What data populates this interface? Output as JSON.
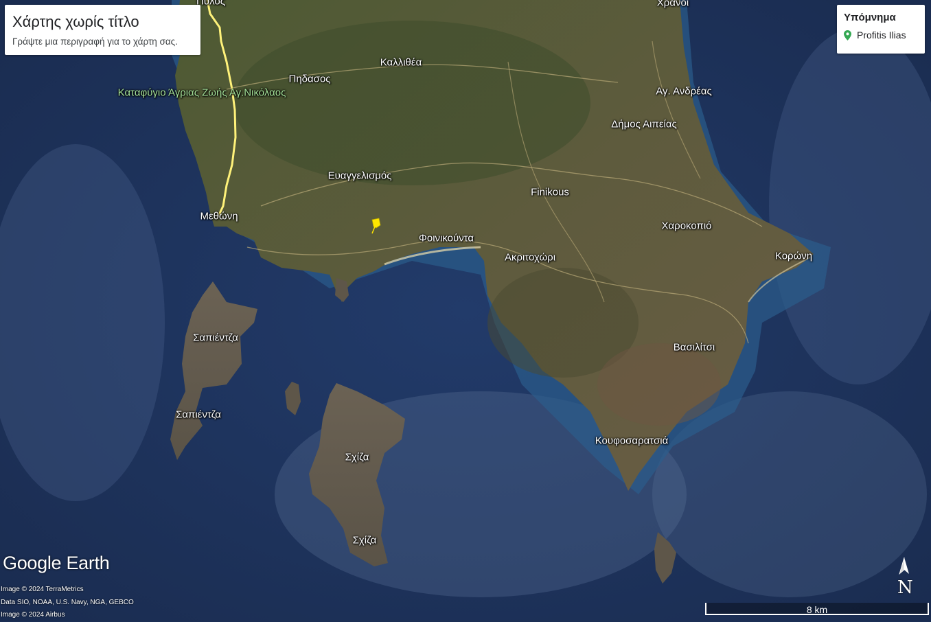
{
  "map": {
    "title": "Χάρτης χωρίς τίτλο",
    "description": "Γράψτε μια περιγραφή για το χάρτη σας.",
    "colors": {
      "sea_deep": "#1b2f55",
      "sea_shallow": "#2d6f9c",
      "land": "#5b5a3c",
      "land_dark": "#3b4a2c",
      "route": "#fff27a",
      "pin": "#ffe600"
    }
  },
  "legend": {
    "title": "Υπόμνημα",
    "items": [
      {
        "label": "Profitis Ilias",
        "icon": "map-pin-icon",
        "color": "#34a853"
      }
    ]
  },
  "places": {
    "pylos": "Πύλος",
    "chranoi": "Χράνοι",
    "kallithea": "Καλλιθέα",
    "pidasos": "Πηδασος",
    "refuge": "Καταφύγιο Άγριας Ζωής Αγ.Νικόλαος",
    "ag_andreas": "Αγ. Ανδρέας",
    "dimos_apeias": "Δήμος Αιπείας",
    "evangelismos": "Ευαγγελισμός",
    "finikous": "Finikous",
    "methoni": "Μεθώνη",
    "foinikounta": "Φοινικούντα",
    "charokopio": "Χαροκοπιό",
    "akritochori": "Ακριτοχώρι",
    "koroni": "Κορώνη",
    "sapientza_1": "Σαπιέντζα",
    "sapientza_2": "Σαπιέντζα",
    "vasilitsi": "Βασιλίτσι",
    "schiza_1": "Σχίζα",
    "schiza_2": "Σχίζα",
    "koufosaratsia": "Κουφοσαρατσιά"
  },
  "branding": {
    "logo": "Google Earth",
    "credits": [
      "Image © 2024 TerraMetrics",
      "Data SIO, NOAA, U.S. Navy, NGA, GEBCO",
      "Image © 2024 Airbus"
    ]
  },
  "compass": {
    "label": "N",
    "icon": "north-arrow-icon"
  },
  "scale": {
    "label": "8 km"
  }
}
